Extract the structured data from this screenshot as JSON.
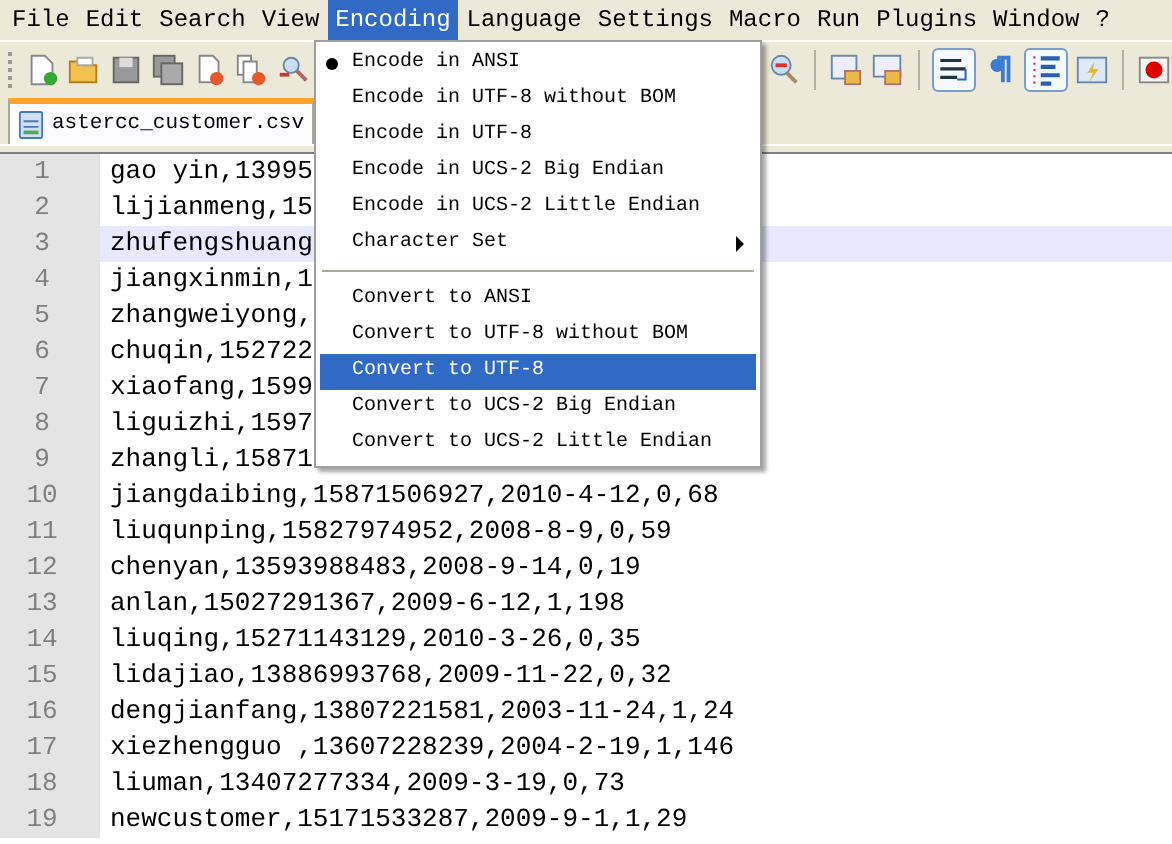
{
  "menubar": [
    {
      "label": "File",
      "selected": false
    },
    {
      "label": "Edit",
      "selected": false
    },
    {
      "label": "Search",
      "selected": false
    },
    {
      "label": "View",
      "selected": false
    },
    {
      "label": "Encoding",
      "selected": true
    },
    {
      "label": "Language",
      "selected": false
    },
    {
      "label": "Settings",
      "selected": false
    },
    {
      "label": "Macro",
      "selected": false
    },
    {
      "label": "Run",
      "selected": false
    },
    {
      "label": "Plugins",
      "selected": false
    },
    {
      "label": "Window",
      "selected": false
    },
    {
      "label": "?",
      "selected": false
    }
  ],
  "tab": {
    "label": "astercc_customer.csv"
  },
  "editor": {
    "lines": [
      {
        "number": "1",
        "text": "gao yin,13995",
        "current": false
      },
      {
        "number": "2",
        "text": "lijianmeng,15",
        "current": false
      },
      {
        "number": "3",
        "text": "zhufengshuang",
        "current": true
      },
      {
        "number": "4",
        "text": "jiangxinmin,1",
        "current": false
      },
      {
        "number": "5",
        "text": "zhangweiyong,",
        "current": false
      },
      {
        "number": "6",
        "text": "chuqin,152722",
        "current": false
      },
      {
        "number": "7",
        "text": "xiaofang,1599",
        "current": false
      },
      {
        "number": "8",
        "text": "liguizhi,1597",
        "current": false
      },
      {
        "number": "9",
        "text": "zhangli,15871",
        "current": false
      },
      {
        "number": "10",
        "text": "jiangdaibing,15871506927,2010-4-12,0,68",
        "current": false
      },
      {
        "number": "11",
        "text": "liuqunping,15827974952,2008-8-9,0,59",
        "current": false
      },
      {
        "number": "12",
        "text": "chenyan,13593988483,2008-9-14,0,19",
        "current": false
      },
      {
        "number": "13",
        "text": "anlan,15027291367,2009-6-12,1,198",
        "current": false
      },
      {
        "number": "14",
        "text": "liuqing,15271143129,2010-3-26,0,35",
        "current": false
      },
      {
        "number": "15",
        "text": "lidajiao,13886993768,2009-11-22,0,32",
        "current": false
      },
      {
        "number": "16",
        "text": "dengjianfang,13807221581,2003-11-24,1,24",
        "current": false
      },
      {
        "number": "17",
        "text": "xiezhengguo ,13607228239,2004-2-19,1,146",
        "current": false
      },
      {
        "number": "18",
        "text": "liuman,13407277334,2009-3-19,0,73",
        "current": false
      },
      {
        "number": "19",
        "text": "newcustomer,15171533287,2009-9-1,1,29",
        "current": false
      }
    ]
  },
  "encoding_menu": {
    "items": [
      {
        "kind": "item",
        "label": "Encode in ANSI",
        "checked": true,
        "selected": false
      },
      {
        "kind": "item",
        "label": "Encode in UTF-8 without BOM",
        "checked": false,
        "selected": false
      },
      {
        "kind": "item",
        "label": "Encode in UTF-8",
        "checked": false,
        "selected": false
      },
      {
        "kind": "item",
        "label": "Encode in UCS-2 Big Endian",
        "checked": false,
        "selected": false
      },
      {
        "kind": "item",
        "label": "Encode in UCS-2 Little Endian",
        "checked": false,
        "selected": false
      },
      {
        "kind": "submenu",
        "label": "Character Set",
        "checked": false,
        "selected": false
      },
      {
        "kind": "separator"
      },
      {
        "kind": "item",
        "label": "Convert to ANSI",
        "checked": false,
        "selected": false
      },
      {
        "kind": "item",
        "label": "Convert to UTF-8 without BOM",
        "checked": false,
        "selected": false
      },
      {
        "kind": "item",
        "label": "Convert to UTF-8",
        "checked": false,
        "selected": true
      },
      {
        "kind": "item",
        "label": "Convert to UCS-2 Big Endian",
        "checked": false,
        "selected": false
      },
      {
        "kind": "item",
        "label": "Convert to UCS-2 Little Endian",
        "checked": false,
        "selected": false
      }
    ]
  }
}
